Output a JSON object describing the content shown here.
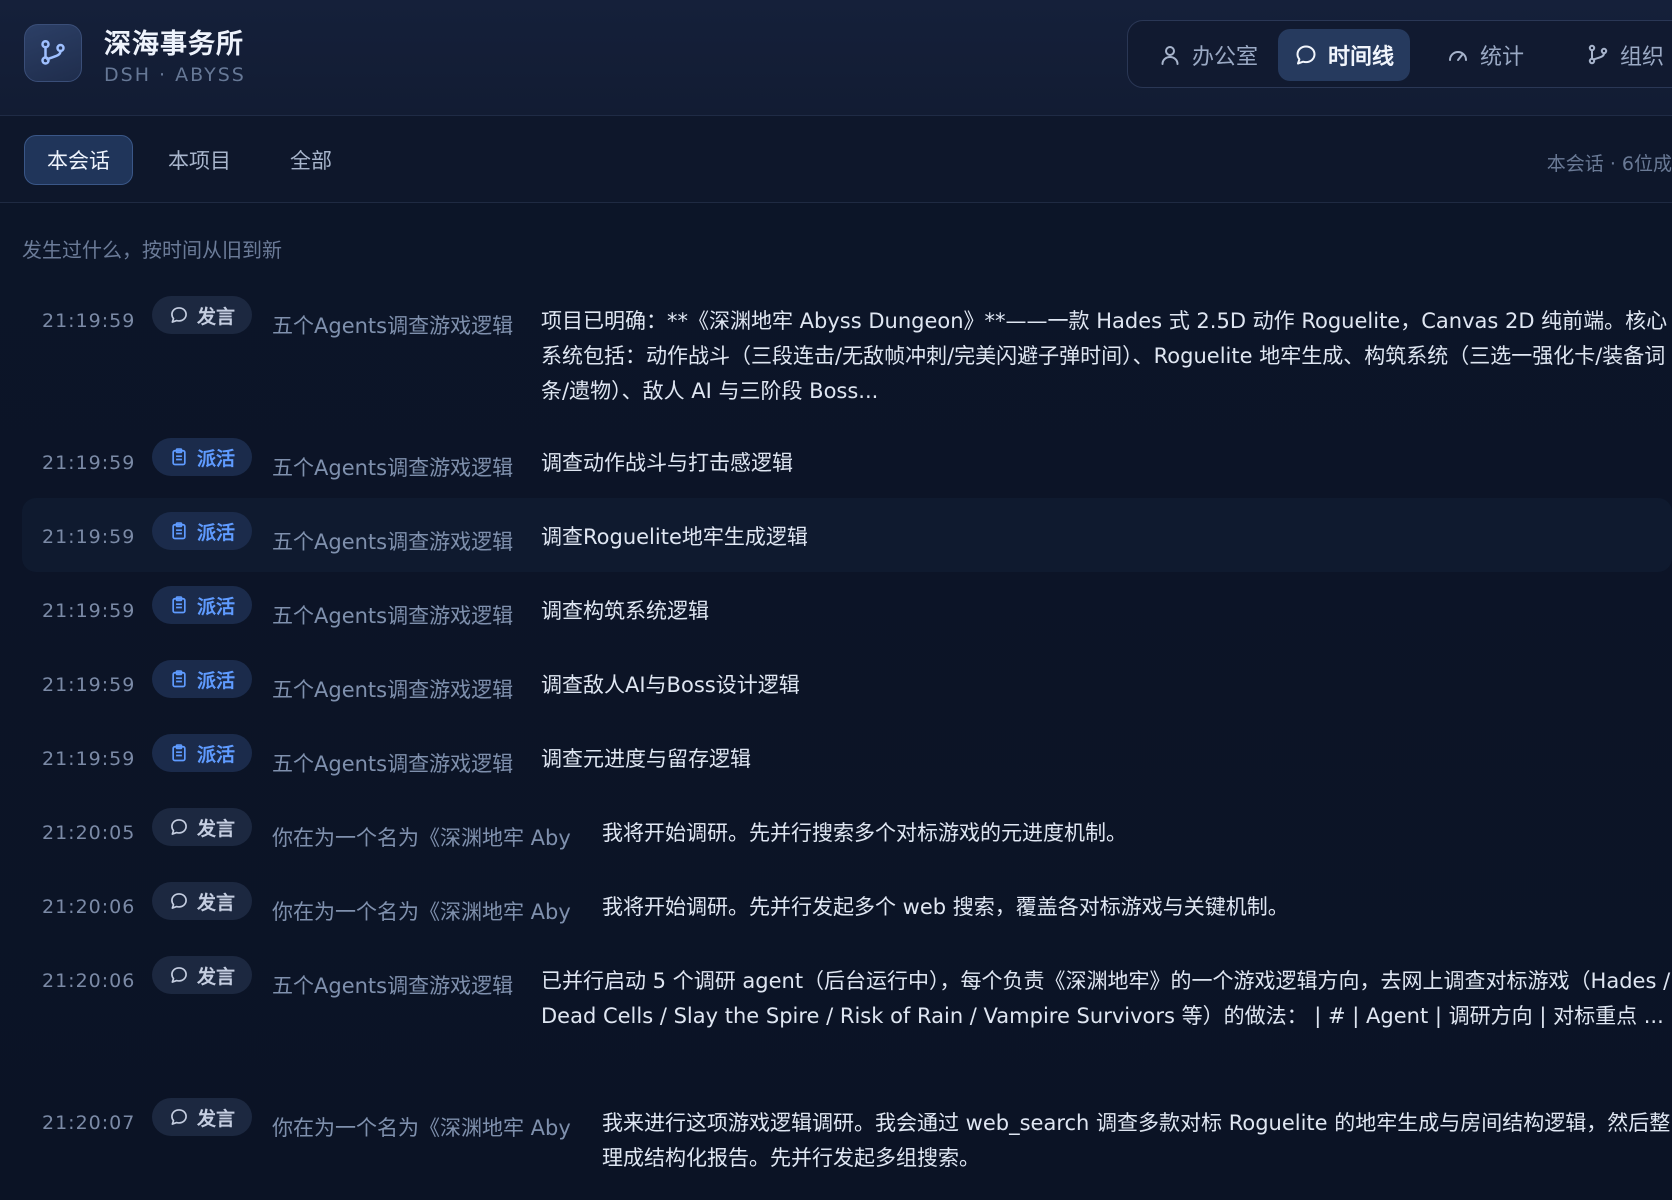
{
  "header": {
    "title": "深海事务所",
    "subtitle": "DSH · ABYSS",
    "nav": [
      {
        "label": "办公室",
        "icon": "user-icon"
      },
      {
        "label": "时间线",
        "icon": "chat-bubble-icon"
      },
      {
        "label": "统计",
        "icon": "gauge-icon"
      },
      {
        "label": "组织",
        "icon": "branch-icon"
      }
    ]
  },
  "filter": {
    "tabs": [
      "本会话",
      "本项目",
      "全部"
    ],
    "info": "本会话 · 6位成"
  },
  "timeline": {
    "subtitle": "发生过什么，按时间从旧到新",
    "events": [
      {
        "time": "21:19:59",
        "type": "发言",
        "source": "五个Agents调查游戏逻辑",
        "text": "项目已明确：**《深渊地牢 Abyss Dungeon》**——一款 Hades 式 2.5D 动作 Roguelite，Canvas 2D 纯前端。核心系统包括：动作战斗（三段连击/无敌帧冲刺/完美闪避子弹时间）、Roguelite 地牢生成、构筑系统（三选一强化卡/装备词条/遗物）、敌人 AI 与三阶段 Boss..."
      },
      {
        "time": "21:19:59",
        "type": "派活",
        "source": "五个Agents调查游戏逻辑",
        "text": "调查动作战斗与打击感逻辑"
      },
      {
        "time": "21:19:59",
        "type": "派活",
        "source": "五个Agents调查游戏逻辑",
        "text": "调查Roguelite地牢生成逻辑"
      },
      {
        "time": "21:19:59",
        "type": "派活",
        "source": "五个Agents调查游戏逻辑",
        "text": "调查构筑系统逻辑"
      },
      {
        "time": "21:19:59",
        "type": "派活",
        "source": "五个Agents调查游戏逻辑",
        "text": "调查敌人AI与Boss设计逻辑"
      },
      {
        "time": "21:19:59",
        "type": "派活",
        "source": "五个Agents调查游戏逻辑",
        "text": "调查元进度与留存逻辑"
      },
      {
        "time": "21:20:05",
        "type": "发言",
        "source": "你在为一个名为《深渊地牢 Aby",
        "text": "我将开始调研。先并行搜索多个对标游戏的元进度机制。"
      },
      {
        "time": "21:20:06",
        "type": "发言",
        "source": "你在为一个名为《深渊地牢 Aby",
        "text": "我将开始调研。先并行发起多个 web 搜索，覆盖各对标游戏与关键机制。"
      },
      {
        "time": "21:20:06",
        "type": "发言",
        "source": "五个Agents调查游戏逻辑",
        "text": "已并行启动 5 个调研 agent（后台运行中），每个负责《深渊地牢》的一个游戏逻辑方向，去网上调查对标游戏（Hades / Dead Cells / Slay the Spire / Risk of Rain / Vampire Survivors 等）的做法： | # | Agent | 调研方向 | 对标重点 ..."
      },
      {
        "time": "21:20:07",
        "type": "发言",
        "source": "你在为一个名为《深渊地牢 Aby",
        "text": "我来进行这项游戏逻辑调研。我会通过 web_search 调查多款对标 Roguelite 的地牢生成与房间结构逻辑，然后整理成结构化报告。先并行发起多组搜索。"
      }
    ]
  }
}
